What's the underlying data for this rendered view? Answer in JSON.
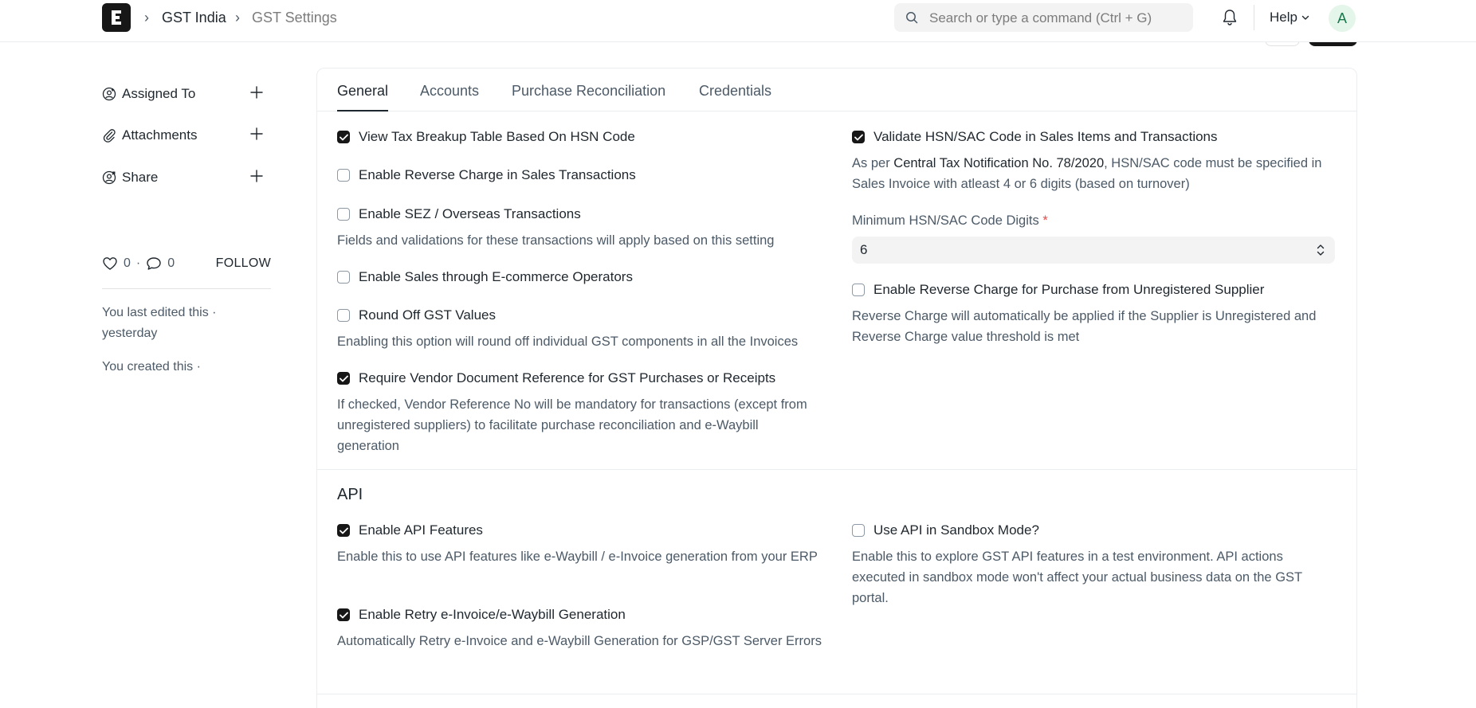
{
  "navbar": {
    "breadcrumbs": [
      "GST India",
      "GST Settings"
    ],
    "search_placeholder": "Search or type a command (Ctrl + G)",
    "help_label": "Help",
    "avatar_initial": "A"
  },
  "sidebar": {
    "items": [
      {
        "label": "Assigned To",
        "icon": "user-add-icon"
      },
      {
        "label": "Attachments",
        "icon": "paperclip-icon"
      },
      {
        "label": "Share",
        "icon": "share-user-icon"
      }
    ],
    "likes": "0",
    "dot": "·",
    "comments": "0",
    "follow_label": "FOLLOW",
    "last_edited": "You last edited this · yesterday",
    "created": "You created this ·"
  },
  "tabs": [
    "General",
    "Accounts",
    "Purchase Reconciliation",
    "Credentials"
  ],
  "general": {
    "left": {
      "hsn_table": {
        "label": "View Tax Breakup Table Based On HSN Code",
        "checked": true
      },
      "reverse_charge_sales": {
        "label": "Enable Reverse Charge in Sales Transactions",
        "checked": false
      },
      "sez": {
        "label": "Enable SEZ / Overseas Transactions",
        "checked": false,
        "desc": "Fields and validations for these transactions will apply based on this setting"
      },
      "ecommerce": {
        "label": "Enable Sales through E-commerce Operators",
        "checked": false
      },
      "round_off": {
        "label": "Round Off GST Values",
        "checked": false,
        "desc": "Enabling this option will round off individual GST components in all the Invoices"
      },
      "vendor_ref": {
        "label": "Require Vendor Document Reference for GST Purchases or Receipts",
        "checked": true,
        "desc": "If checked, Vendor Reference No will be mandatory for transactions (except from unregistered suppliers) to facilitate purchase reconciliation and e-Waybill generation"
      }
    },
    "right": {
      "validate_hsn": {
        "label": "Validate HSN/SAC Code in Sales Items and Transactions",
        "checked": true,
        "desc_prefix": "As per ",
        "desc_link": "Central Tax Notification No. 78/2020",
        "desc_suffix": ", HSN/SAC code must be specified in Sales Invoice with atleast 4 or 6 digits (based on turnover)"
      },
      "min_digits": {
        "label": "Minimum HSN/SAC Code Digits",
        "required_mark": "*",
        "value": "6"
      },
      "reverse_charge_purchase": {
        "label": "Enable Reverse Charge for Purchase from Unregistered Supplier",
        "checked": false,
        "desc": "Reverse Charge will automatically be applied if the Supplier is Unregistered and Reverse Charge value threshold is met"
      }
    }
  },
  "api": {
    "title": "API",
    "enable_api": {
      "label": "Enable API Features",
      "checked": true,
      "desc": "Enable this to use API features like e-Waybill / e-Invoice generation from your ERP"
    },
    "retry": {
      "label": "Enable Retry e-Invoice/e-Waybill Generation",
      "checked": true,
      "desc": "Automatically Retry e-Invoice and e-Waybill Generation for GSP/GST Server Errors"
    },
    "sandbox": {
      "label": "Use API in Sandbox Mode?",
      "checked": false,
      "desc": "Enable this to explore GST API features in a test environment. API actions executed in sandbox mode won't affect your actual business data on the GST portal."
    }
  },
  "colors": {
    "accent": "#171717",
    "text": "#1f272e",
    "muted": "#4c5a67",
    "required": "#e24c4c"
  }
}
